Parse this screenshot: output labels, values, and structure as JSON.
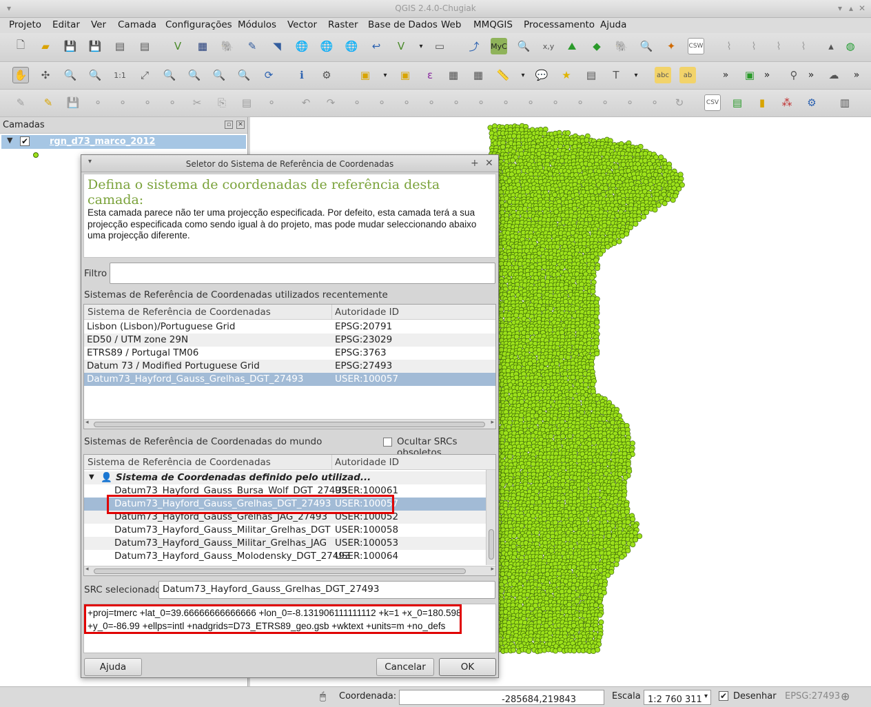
{
  "window": {
    "title": "QGIS 2.4.0-Chugiak"
  },
  "menu": [
    "Projeto",
    "Editar",
    "Ver",
    "Camada",
    "Configurações",
    "Módulos",
    "Vector",
    "Raster",
    "Base de Dados",
    "Web",
    "MMQGIS",
    "Processamento",
    "Ajuda"
  ],
  "toolbar_text": {
    "myc": "MyC",
    "xy": "x,y",
    "csw": "CSW",
    "abc": "abc",
    "ab": "ab",
    "csv": "CSV",
    "overflow": "»"
  },
  "layers_panel": {
    "title": "Camadas",
    "layer_name": "rgn_d73_marco_2012"
  },
  "dialog": {
    "title": "Seletor do Sistema de Referência de Coordenadas",
    "heading": "Defina o sistema de coordenadas de referência desta camada:",
    "description": "Esta camada parece não ter uma projecção especificada. Por defeito, esta camada terá a sua projecção especificada como sendo igual à do projeto, mas pode mudar seleccionando abaixo uma projecção diferente.",
    "filter_label": "Filtro",
    "filter_value": "",
    "recent_label": "Sistemas de Referência de Coordenadas utilizados recentemente",
    "col_crs": "Sistema de Referência de Coordenadas",
    "col_auth": "Autoridade ID",
    "recent_rows": [
      {
        "name": "Lisbon (Lisbon)/Portuguese Grid",
        "id": "EPSG:20791"
      },
      {
        "name": "ED50 / UTM zone 29N",
        "id": "EPSG:23029"
      },
      {
        "name": "ETRS89 / Portugal TM06",
        "id": "EPSG:3763"
      },
      {
        "name": "Datum 73 / Modified Portuguese Grid",
        "id": "EPSG:27493"
      },
      {
        "name": "Datum73_Hayford_Gauss_Grelhas_DGT_27493",
        "id": "USER:100057"
      }
    ],
    "world_label": "Sistemas de Referência de Coordenadas do mundo",
    "hide_obsolete_label": "Ocultar SRCs obsoletos",
    "hide_obsolete_checked": false,
    "world_group": "Sistema de Coordenadas definido pelo utilizad...",
    "world_rows": [
      {
        "name": "Datum73_Hayford_Gauss_Bursa_Wolf_DGT_27493",
        "id": "USER:100061"
      },
      {
        "name": "Datum73_Hayford_Gauss_Grelhas_DGT_27493",
        "id": "USER:100057"
      },
      {
        "name": "Datum73_Hayford_Gauss_Grelhas_JAG_27493",
        "id": "USER:100052"
      },
      {
        "name": "Datum73_Hayford_Gauss_Militar_Grelhas_DGT",
        "id": "USER:100058"
      },
      {
        "name": "Datum73_Hayford_Gauss_Militar_Grelhas_JAG",
        "id": "USER:100053"
      },
      {
        "name": "Datum73_Hayford_Gauss_Molodensky_DGT_27493",
        "id": "USER:100064"
      }
    ],
    "selected_label": "SRC selecionado:",
    "selected_value": "Datum73_Hayford_Gauss_Grelhas_DGT_27493",
    "proj_line1": "+proj=tmerc +lat_0=39.66666666666666 +lon_0=-8.131906111111112 +k=1 +x_0=180.598",
    "proj_line2": "+y_0=-86.99 +ellps=intl +nadgrids=D73_ETRS89_geo.gsb +wktext +units=m +no_defs",
    "help_button": "Ajuda",
    "cancel_button": "Cancelar",
    "ok_button": "OK"
  },
  "statusbar": {
    "coord_label": "Coordenada:",
    "coord_value": "-285684,219843",
    "scale_label": "Escala",
    "scale_value": "1:2 760 311",
    "render_label": "Desenhar",
    "render_checked": true,
    "crs": "EPSG:27493"
  },
  "colors": {
    "points": "#9de21a",
    "point_outline": "#3f6a08",
    "selection": "#a2bbd6",
    "highlight_box": "#e00000",
    "heading": "#7aa23a"
  }
}
